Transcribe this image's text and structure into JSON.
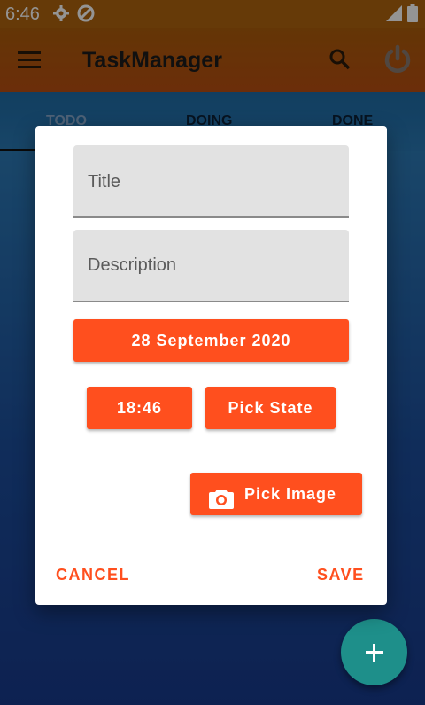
{
  "status_bar": {
    "time": "6:46",
    "icons": [
      "gear-icon",
      "sync-icon",
      "signal-icon",
      "battery-icon"
    ]
  },
  "app_bar": {
    "title": "TaskManager",
    "icons": [
      "menu-icon",
      "search-icon",
      "power-icon"
    ]
  },
  "tabs": [
    {
      "label": "TODO",
      "selected": true
    },
    {
      "label": "DOING",
      "selected": false
    },
    {
      "label": "DONE",
      "selected": false
    }
  ],
  "dialog": {
    "title_placeholder": "Title",
    "description_placeholder": "Description",
    "date_button": "28 September 2020",
    "time_button": "18:46",
    "state_button": "Pick State",
    "image_button": "Pick Image",
    "cancel_button": "CANCEL",
    "save_button": "SAVE"
  },
  "fab": {
    "icon": "plus-icon"
  },
  "colors": {
    "accent": "#ff4f1e",
    "app_bar": "#b15a0d",
    "fab": "#1e8f8a",
    "tab_bar": "#2a74b0"
  }
}
